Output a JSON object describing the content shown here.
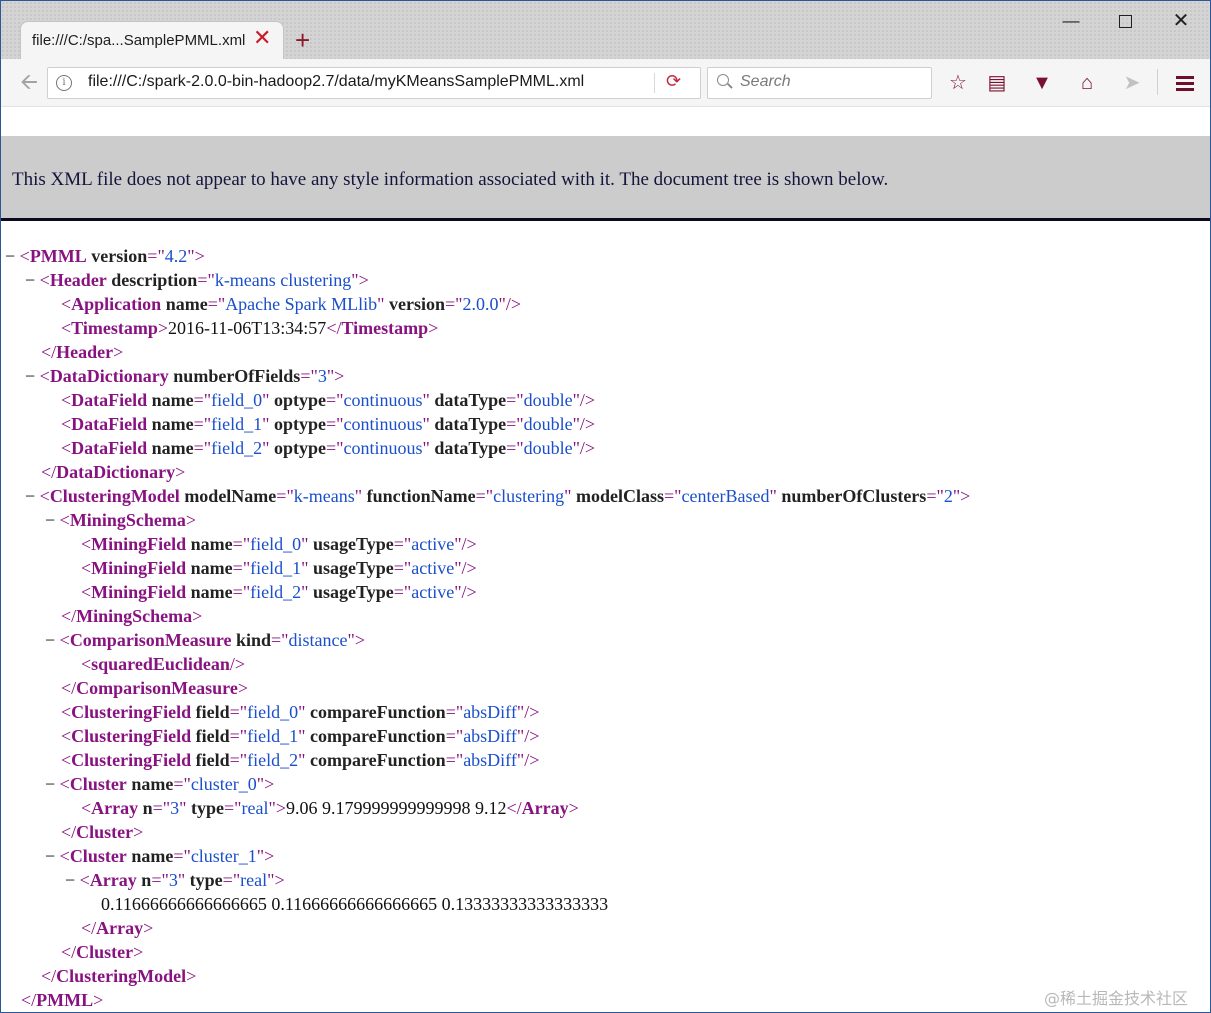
{
  "browser": {
    "tab_title": "file:///C:/spa...SamplePMML.xml",
    "close_glyph": "✕",
    "new_tab_glyph": "+",
    "url": "file:///C:/spark-2.0.0-bin-hadoop2.7/data/myKMeansSamplePMML.xml",
    "search_placeholder": "Search",
    "icons": [
      "back-arrow-icon",
      "info-icon",
      "reload-icon",
      "search-icon",
      "star-icon",
      "reading-list-icon",
      "pocket-icon",
      "home-icon",
      "send-icon",
      "menu-icon"
    ],
    "accent_color": "#8b1a2c"
  },
  "page": {
    "info_message": "This XML file does not appear to have any style information associated with it. The document tree is shown below."
  },
  "xml": {
    "fold_glyph": "−",
    "pmml_tag": "PMML",
    "version_attr": "version",
    "pmml_version": "4.2",
    "header_tag": "Header",
    "description_attr": "description",
    "header_description": "k-means clustering",
    "application_tag": "Application",
    "name_attr": "name",
    "application_name": "Apache Spark MLlib",
    "application_version": "2.0.0",
    "timestamp_tag": "Timestamp",
    "timestamp_value": "2016-11-06T13:34:57",
    "data_dictionary_tag": "DataDictionary",
    "number_of_fields_attr": "numberOfFields",
    "number_of_fields": "3",
    "data_field_tag": "DataField",
    "optype_attr": "optype",
    "data_type_attr": "dataType",
    "data_fields": [
      {
        "name": "field_0",
        "optype": "continuous",
        "data_type": "double"
      },
      {
        "name": "field_1",
        "optype": "continuous",
        "data_type": "double"
      },
      {
        "name": "field_2",
        "optype": "continuous",
        "data_type": "double"
      }
    ],
    "clustering_model_tag": "ClusteringModel",
    "model_name_attr": "modelName",
    "model_name": "k-means",
    "function_name_attr": "functionName",
    "function_name": "clustering",
    "model_class_attr": "modelClass",
    "model_class": "centerBased",
    "number_of_clusters_attr": "numberOfClusters",
    "number_of_clusters": "2",
    "mining_schema_tag": "MiningSchema",
    "mining_field_tag": "MiningField",
    "usage_type_attr": "usageType",
    "mining_fields": [
      {
        "name": "field_0",
        "usage_type": "active"
      },
      {
        "name": "field_1",
        "usage_type": "active"
      },
      {
        "name": "field_2",
        "usage_type": "active"
      }
    ],
    "comparison_measure_tag": "ComparisonMeasure",
    "kind_attr": "kind",
    "comparison_kind": "distance",
    "squared_euclidean_tag": "squaredEuclidean",
    "clustering_field_tag": "ClusteringField",
    "field_attr": "field",
    "compare_function_attr": "compareFunction",
    "clustering_fields": [
      {
        "field": "field_0",
        "compare_function": "absDiff"
      },
      {
        "field": "field_1",
        "compare_function": "absDiff"
      },
      {
        "field": "field_2",
        "compare_function": "absDiff"
      }
    ],
    "cluster_tag": "Cluster",
    "array_tag": "Array",
    "n_attr": "n",
    "type_attr": "type",
    "clusters": [
      {
        "name": "cluster_0",
        "n": "3",
        "type": "real",
        "values": "9.06 9.179999999999998 9.12"
      },
      {
        "name": "cluster_1",
        "n": "3",
        "type": "real",
        "values": "0.11666666666666665 0.11666666666666665 0.13333333333333333"
      }
    ]
  },
  "watermark": "@稀土掘金技术社区"
}
